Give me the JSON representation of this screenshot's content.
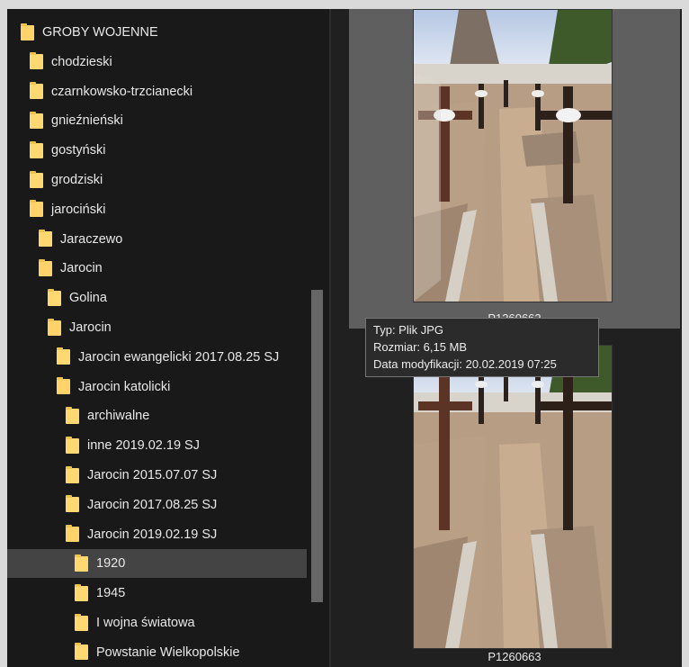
{
  "tree": {
    "items": [
      {
        "label": "GROBY WOJENNE",
        "selected": false
      },
      {
        "label": "chodzieski",
        "selected": false
      },
      {
        "label": "czarnkowsko-trzcianecki",
        "selected": false
      },
      {
        "label": "gnieźnieński",
        "selected": false
      },
      {
        "label": "gostyński",
        "selected": false
      },
      {
        "label": "grodziski",
        "selected": false
      },
      {
        "label": "jarociński",
        "selected": false
      },
      {
        "label": "Jaraczewo",
        "selected": false
      },
      {
        "label": "Jarocin",
        "selected": false
      },
      {
        "label": "Golina",
        "selected": false
      },
      {
        "label": "Jarocin",
        "selected": false
      },
      {
        "label": "Jarocin ewangelicki 2017.08.25 SJ",
        "selected": false
      },
      {
        "label": "Jarocin katolicki",
        "selected": false
      },
      {
        "label": "archiwalne",
        "selected": false
      },
      {
        "label": "inne 2019.02.19 SJ",
        "selected": false
      },
      {
        "label": "Jarocin 2015.07.07 SJ",
        "selected": false
      },
      {
        "label": "Jarocin 2017.08.25 SJ",
        "selected": false
      },
      {
        "label": "Jarocin 2019.02.19 SJ",
        "selected": false
      },
      {
        "label": "1920",
        "selected": true
      },
      {
        "label": "1945",
        "selected": false
      },
      {
        "label": "I wojna światowa",
        "selected": false
      },
      {
        "label": "Powstanie Wielkopolskie",
        "selected": false
      }
    ]
  },
  "thumbnails": [
    {
      "caption": "P1260662"
    },
    {
      "caption": "P1260663"
    }
  ],
  "tooltip": {
    "type": "Typ: Plik JPG",
    "size": "Rozmiar: 6,15 MB",
    "modified": "Data modyfikacji: 20.02.2019 07:25"
  },
  "colors": {
    "folder": "#ffd872",
    "selected_row": "#444444",
    "background": "#191919"
  }
}
